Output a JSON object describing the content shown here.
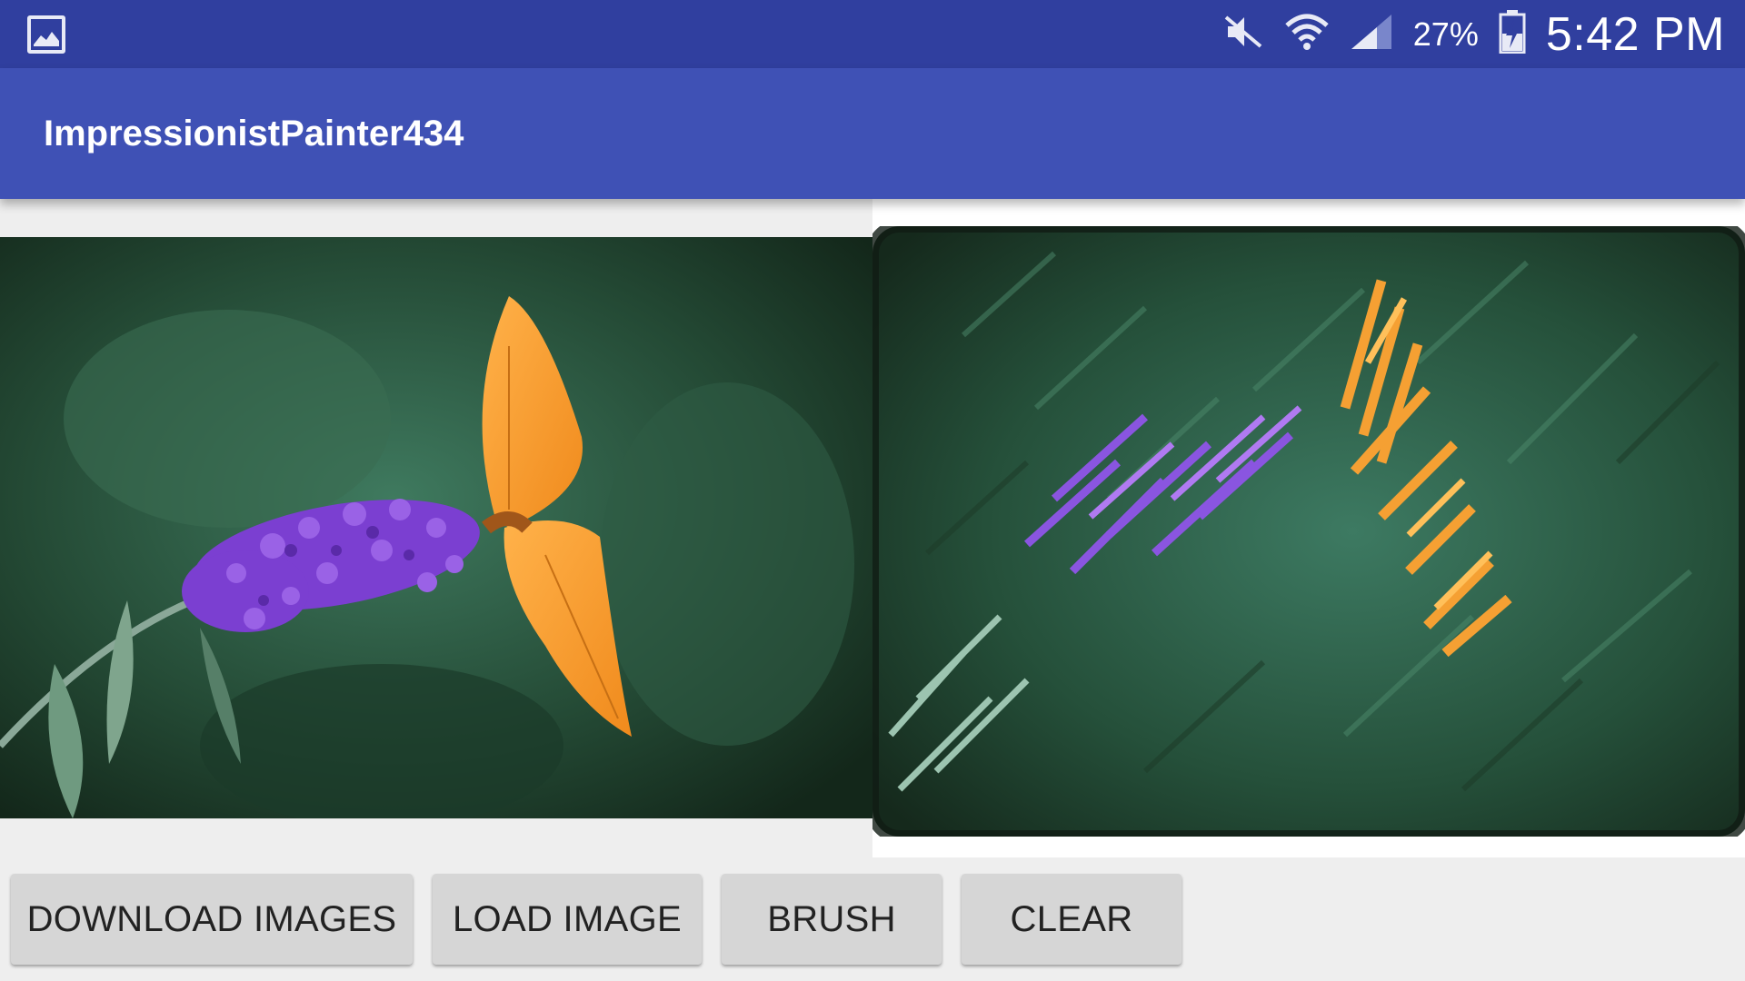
{
  "status_bar": {
    "battery_percent": "27%",
    "time": "5:42 PM",
    "icons": [
      "gallery-icon",
      "mute-icon",
      "wifi-icon",
      "signal-icon",
      "battery-charging-icon"
    ]
  },
  "app_bar": {
    "title": "ImpressionistPainter434"
  },
  "images": {
    "source": "butterfly-on-purple-flower-photo",
    "painted": "impressionist-painted-canvas"
  },
  "buttons": {
    "download_label": "DOWNLOAD IMAGES",
    "load_label": "LOAD IMAGE",
    "brush_label": "BRUSH",
    "clear_label": "CLEAR"
  },
  "colors": {
    "status_bar": "#303f9f",
    "app_bar": "#3f51b5",
    "button": "#d6d6d6"
  }
}
